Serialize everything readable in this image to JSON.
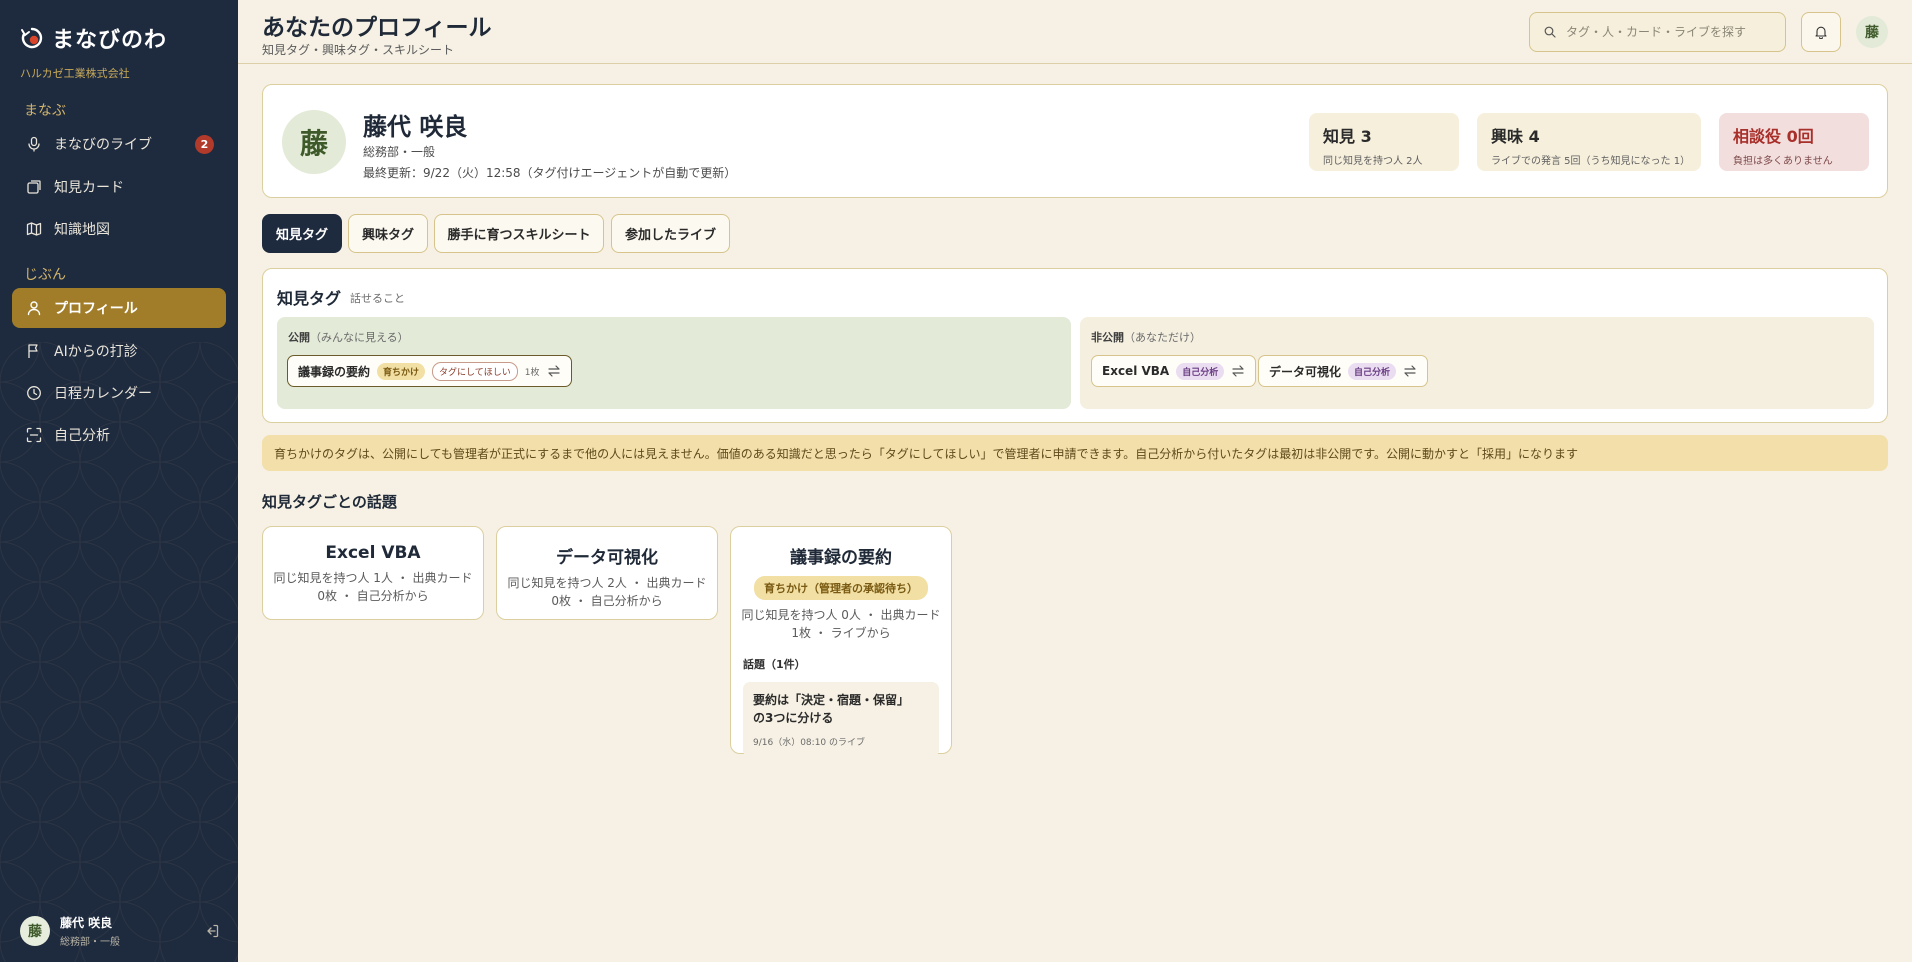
{
  "app": {
    "name": "まなびのわ",
    "company": "ハルカゼ工業株式会社"
  },
  "sidebar": {
    "sections": [
      {
        "label": "まなぶ",
        "items": [
          {
            "label": "まなびのライブ",
            "icon": "mic-icon",
            "badge": "2"
          },
          {
            "label": "知見カード",
            "icon": "cards-icon"
          },
          {
            "label": "知識地図",
            "icon": "map-icon"
          }
        ]
      },
      {
        "label": "じぶん",
        "items": [
          {
            "label": "プロフィール",
            "icon": "user-icon",
            "active": true
          },
          {
            "label": "AIからの打診",
            "icon": "flag-icon"
          },
          {
            "label": "日程カレンダー",
            "icon": "clock-icon"
          },
          {
            "label": "自己分析",
            "icon": "scan-icon"
          }
        ]
      }
    ],
    "user": {
      "initial": "藤",
      "name": "藤代 咲良",
      "dept": "総務部・一般"
    }
  },
  "header": {
    "title": "あなたのプロフィール",
    "subtitle": "知見タグ・興味タグ・スキルシート",
    "search_placeholder": "タグ・人・カード・ライブを探す",
    "avatar_initial": "藤"
  },
  "profile": {
    "initial": "藤",
    "name": "藤代 咲良",
    "dept": "総務部・一般",
    "updated": "最終更新：9/22（火）12:58（タグ付けエージェントが自動で更新）",
    "stats": [
      {
        "title": "知見 3",
        "sub": "同じ知見を持つ人 2人"
      },
      {
        "title": "興味 4",
        "sub": "ライブでの発言 5回（うち知見になった 1）"
      },
      {
        "title": "相談役 0回",
        "sub": "負担は多くありません"
      }
    ]
  },
  "tabs": [
    "知見タグ",
    "興味タグ",
    "勝手に育つスキルシート",
    "参加したライブ"
  ],
  "tags_panel": {
    "title": "知見タグ",
    "hint": "話せること",
    "public_label": "公開",
    "public_note": "（みんなに見える）",
    "private_label": "非公開",
    "private_note": "（あなただけ）",
    "public_tags": [
      {
        "name": "議事録の要約",
        "status": "育ちかけ",
        "request": "タグにしてほしい",
        "count": "1枚"
      }
    ],
    "private_tags": [
      {
        "name": "Excel VBA",
        "source": "自己分析"
      },
      {
        "name": "データ可視化",
        "source": "自己分析"
      }
    ]
  },
  "notice": "育ちかけのタグは、公開にしても管理者が正式にするまで他の人には見えません。価値のある知識だと思ったら「タグにしてほしい」で管理者に申請できます。自己分析から付いたタグは最初は非公開です。公開に動かすと「採用」になります",
  "topics_heading": "知見タグごとの話題",
  "topics": [
    {
      "title": "Excel VBA",
      "meta1": "同じ知見を持つ人 1人 ・ 出典カード",
      "meta2": "0枚 ・ 自己分析から"
    },
    {
      "title": "データ可視化",
      "meta1": "同じ知見を持つ人 2人 ・ 出典カード",
      "meta2": "0枚 ・ 自己分析から"
    },
    {
      "title": "議事録の要約",
      "status": "育ちかけ（管理者の承認待ち）",
      "meta1": "同じ知見を持つ人 0人 ・ 出典カード",
      "meta2": "1枚 ・ ライブから",
      "sub": "話題（1件）",
      "item_title_1": "要約は「決定・宿題・保留」",
      "item_title_2": "の3つに分ける",
      "item_meta": "9/16（水）08:10 のライブ"
    }
  ],
  "colors": {
    "sidebar": "#1e2a3e",
    "accent": "#a17d2a",
    "background": "#f6f1e4",
    "danger": "#a8302a"
  }
}
